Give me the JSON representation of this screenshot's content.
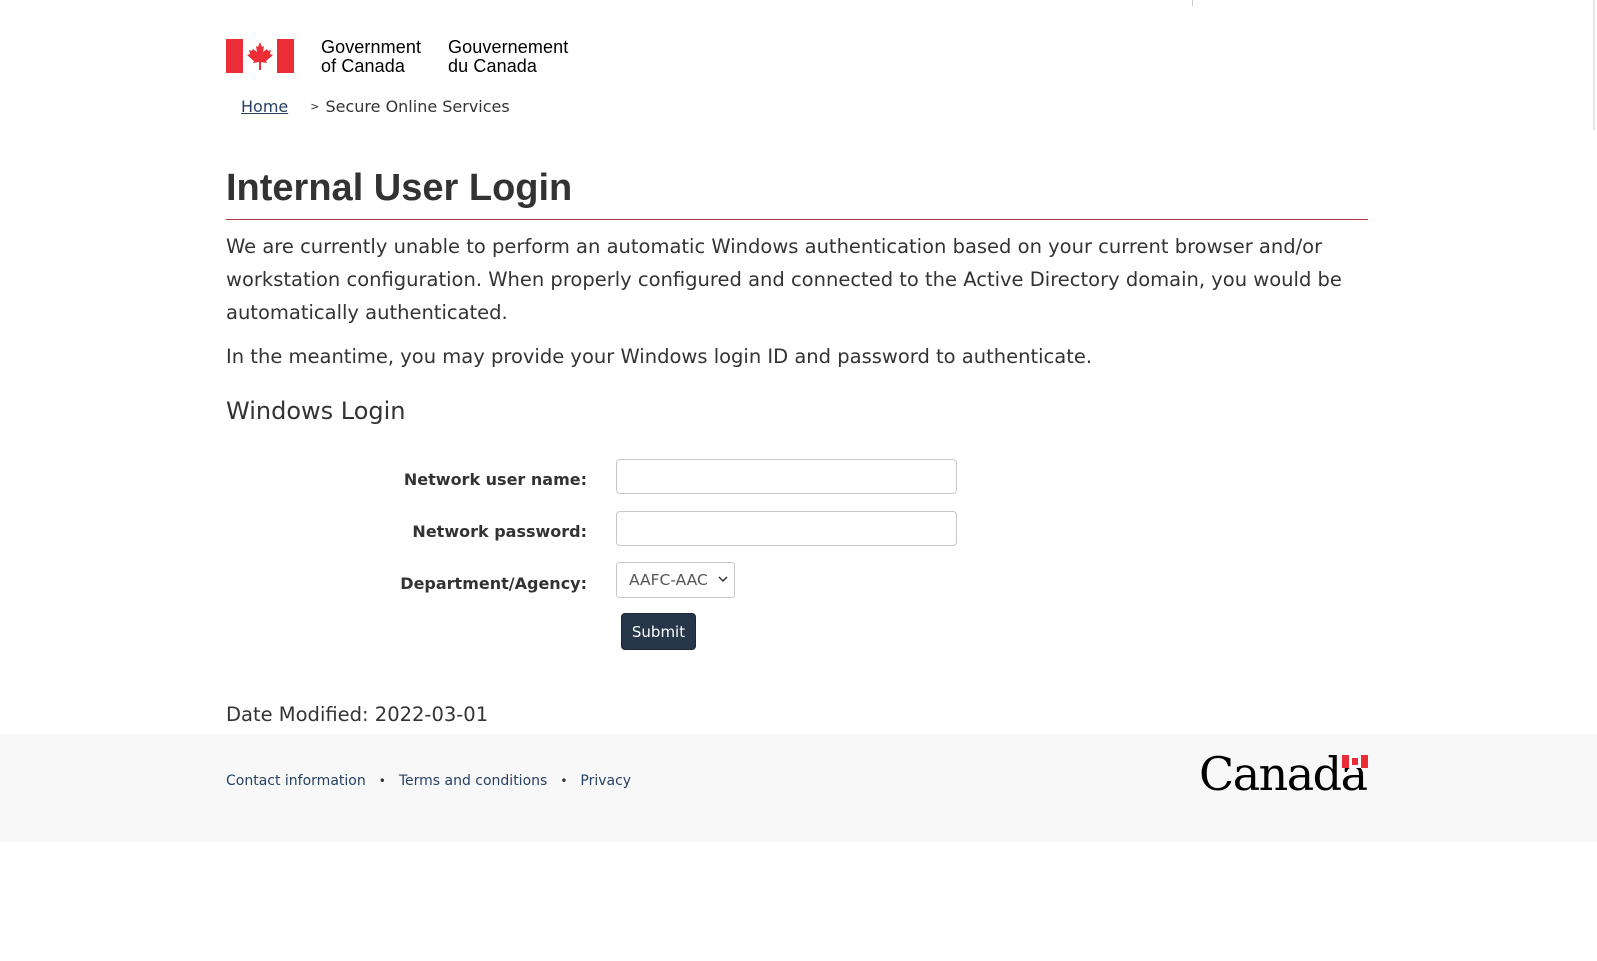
{
  "header": {
    "signature_en_line1": "Government",
    "signature_en_line2": "of Canada",
    "signature_fr_line1": "Gouvernement",
    "signature_fr_line2": "du Canada"
  },
  "breadcrumb": {
    "home": "Home",
    "separator": ">",
    "current": "Secure Online Services"
  },
  "main": {
    "title": "Internal User Login",
    "intro": "We are currently unable to perform an automatic Windows authentication based on your current browser and/or workstation configuration. When properly configured and connected to the Active Directory domain, you would be automatically authenticated.",
    "intro2": "In the meantime, you may provide your Windows login ID and password to authenticate.",
    "section_heading": "Windows Login"
  },
  "form": {
    "username_label": "Network user name:",
    "username_value": "",
    "password_label": "Network password:",
    "password_value": "",
    "department_label": "Department/Agency:",
    "department_selected": "AAFC-AAC",
    "submit_label": "Submit"
  },
  "date_modified": "Date Modified: 2022-03-01",
  "footer": {
    "links": [
      "Contact information",
      "Terms and conditions",
      "Privacy"
    ],
    "separator": "•",
    "wordmark": "Canada"
  },
  "colors": {
    "flag_red": "#eb2d37",
    "title_rule": "#af3c43",
    "link": "#284162",
    "button_bg": "#26374a",
    "footer_bg": "#f8f8f8"
  }
}
